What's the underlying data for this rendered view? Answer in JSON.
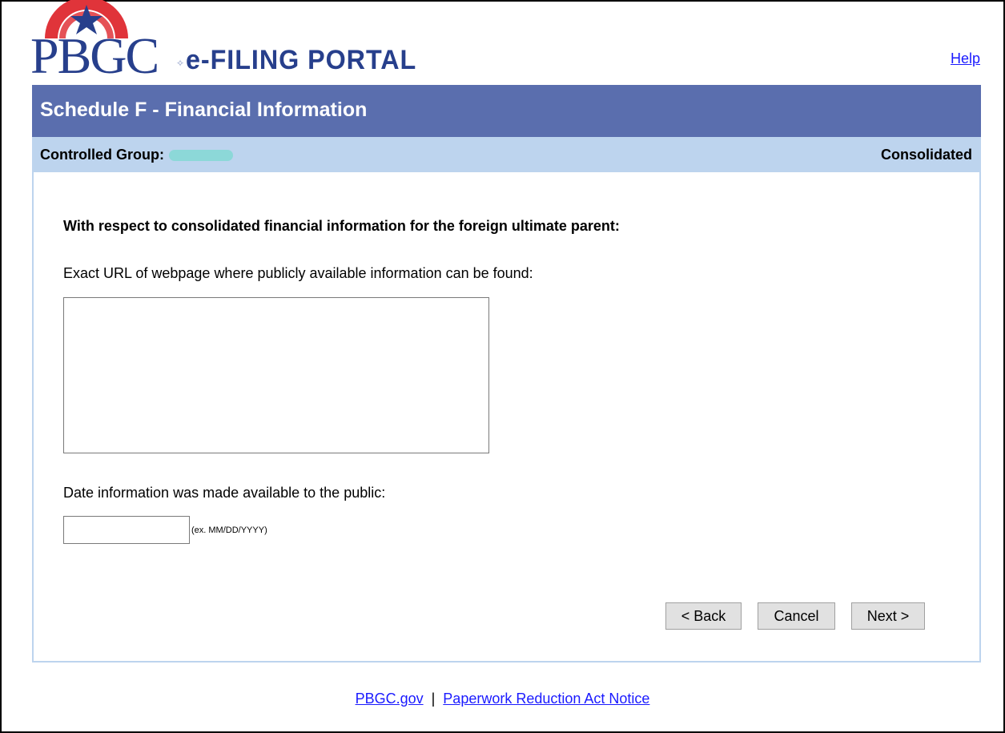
{
  "header": {
    "logo": {
      "letters": "PBGC",
      "subtitle": "e-FILING PORTAL"
    },
    "help_link": "Help"
  },
  "title_bar": {
    "title": "Schedule F - Financial Information"
  },
  "subheader": {
    "controlled_group_label": "Controlled Group:",
    "filing_type": "Consolidated"
  },
  "form": {
    "question": "With respect to consolidated financial information for the foreign ultimate parent:",
    "url_label": "Exact URL of webpage where publicly available information can be found:",
    "url_value": "",
    "date_label": "Date information was made available to the public:",
    "date_value": "",
    "date_hint": "(ex. MM/DD/YYYY)"
  },
  "buttons": {
    "back": "< Back",
    "cancel": "Cancel",
    "next": "Next >"
  },
  "footer": {
    "link1": "PBGC.gov",
    "separator": "|",
    "link2": "Paperwork Reduction Act Notice"
  },
  "colors": {
    "title_bar": "#5a6eae",
    "subheader": "#bdd4ee",
    "logo_blue": "#273f8c",
    "logo_red": "#e0343a",
    "link": "#1a1aff"
  }
}
